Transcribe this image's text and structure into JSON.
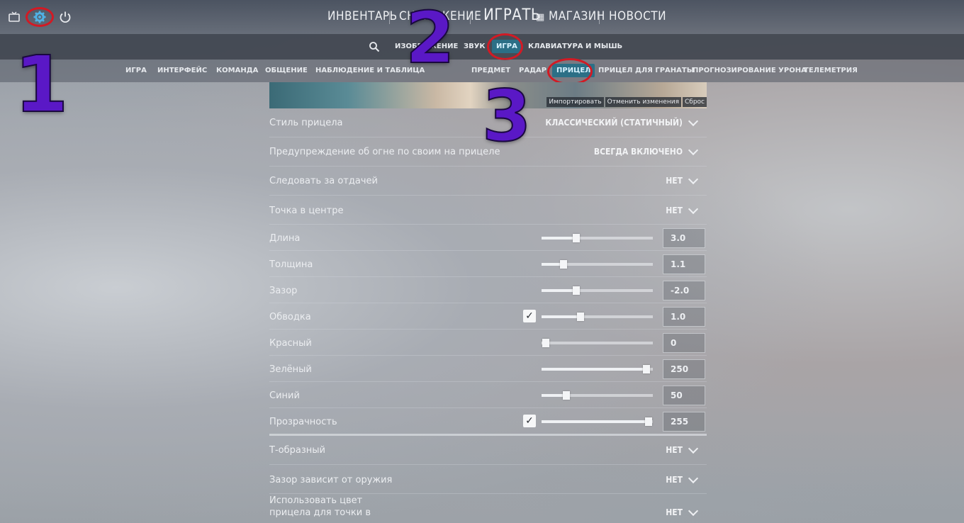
{
  "topbar": {
    "icons": [
      "tv-icon",
      "gear-icon",
      "power-icon"
    ],
    "nav": [
      "ИНВЕНТАРЬ",
      "СНАРЯЖЕНИЕ",
      "ИГРАТЬ",
      "МАГАЗИН",
      "НОВОСТИ"
    ]
  },
  "subnav": {
    "items": [
      "ИЗОБРАЖЕНИЕ",
      "ЗВУК",
      "ИГРА",
      "КЛАВИАТУРА И МЫШЬ"
    ],
    "active": "ИГРА"
  },
  "tabs": {
    "items": [
      "ИГРА",
      "ИНТЕРФЕЙС",
      "КОМАНДА",
      "ОБЩЕНИЕ",
      "НАБЛЮДЕНИЕ И ТАБЛИЦА",
      "ПРЕДМЕТ",
      "РАДАР",
      "ПРИЦЕЛ",
      "ПРИЦЕЛ ДЛЯ ГРАНАТЫ",
      "ПРОГНОЗИРОВАНИЕ УРОНА",
      "ТЕЛЕМЕТРИЯ"
    ],
    "active": "ПРИЦЕЛ"
  },
  "preview": {
    "buttons": [
      "Импортировать",
      "Отменить изменения",
      "Сброс"
    ]
  },
  "settings": {
    "style": {
      "label": "Стиль прицела",
      "value": "КЛАССИЧЕСКИЙ (СТАТИЧНЫЙ)"
    },
    "friendly_fire": {
      "label": "Предупреждение об огне по своим на прицеле",
      "value": "ВСЕГДА ВКЛЮЧЕНО"
    },
    "follow_recoil": {
      "label": "Следовать за отдачей",
      "value": "НЕТ"
    },
    "center_dot": {
      "label": "Точка в центре",
      "value": "НЕТ"
    },
    "length": {
      "label": "Длина",
      "value": "3.0",
      "fraction": 0.31
    },
    "thickness": {
      "label": "Толщина",
      "value": "1.1",
      "fraction": 0.2
    },
    "gap": {
      "label": "Зазор",
      "value": "-2.0",
      "fraction": 0.31
    },
    "outline": {
      "label": "Обводка",
      "value": "1.0",
      "fraction": 0.35,
      "checked": true
    },
    "red": {
      "label": "Красный",
      "value": "0",
      "fraction": 0.04
    },
    "green": {
      "label": "Зелёный",
      "value": "250",
      "fraction": 0.94
    },
    "blue": {
      "label": "Синий",
      "value": "50",
      "fraction": 0.22
    },
    "alpha": {
      "label": "Прозрачность",
      "value": "255",
      "fraction": 0.96,
      "checked": true
    },
    "t_shape": {
      "label": "Т-образный",
      "value": "НЕТ"
    },
    "weapon_gap": {
      "label": "Зазор зависит от оружия",
      "value": "НЕТ"
    },
    "dot_color": {
      "label_lines": [
        "Использовать цвет",
        "прицела для точки в"
      ],
      "value": "НЕТ"
    }
  },
  "annotations": [
    "1",
    "2",
    "3"
  ],
  "colors": {
    "accent": "#2c6f86",
    "highlight": "#d21a24",
    "annotation": "#5a18c6"
  }
}
